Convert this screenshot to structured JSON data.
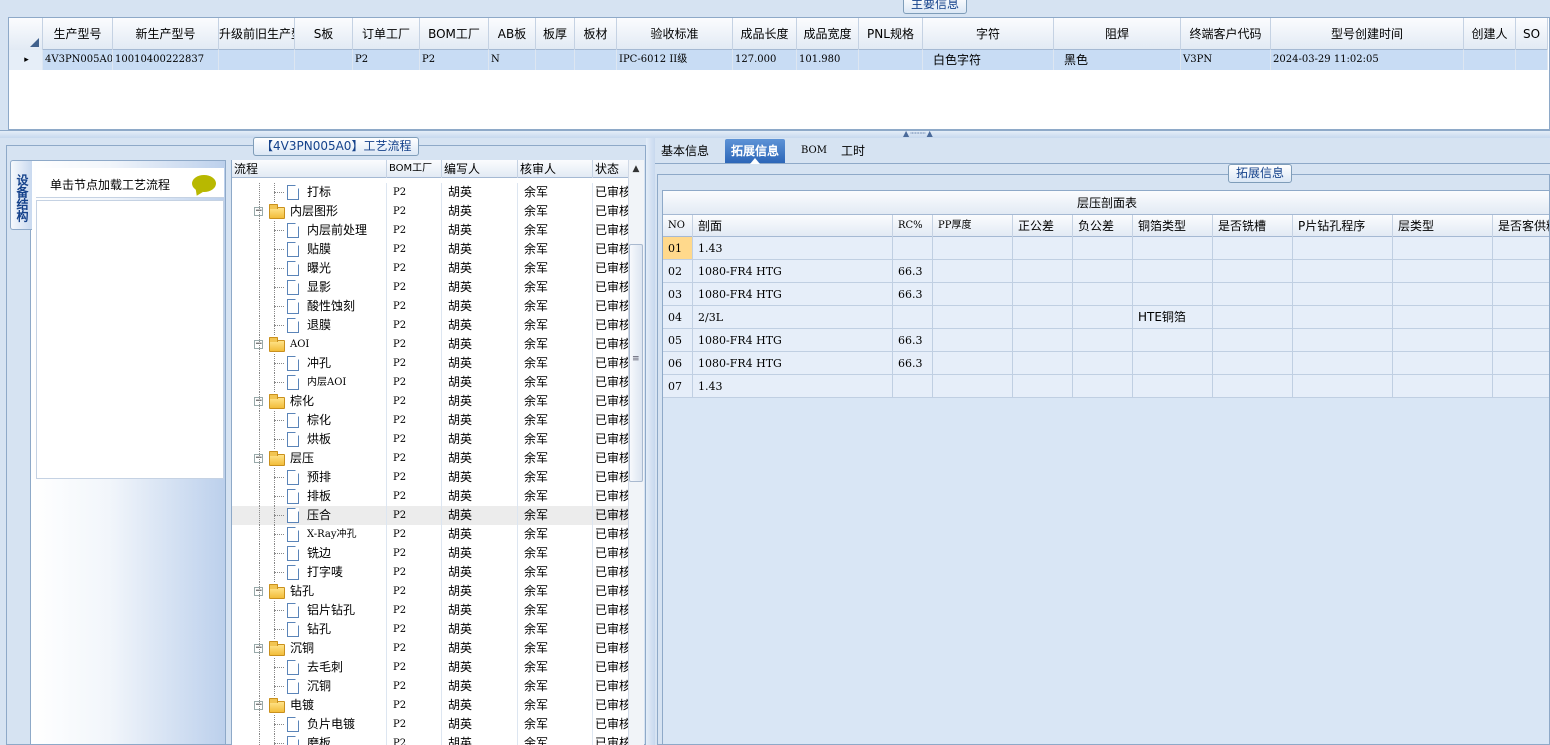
{
  "main_info": {
    "caption": "主要信息",
    "columns": [
      "生产型号",
      "新生产型号",
      "升级前旧生产型号",
      "S板",
      "订单工厂",
      "BOM工厂",
      "AB板",
      "板厚",
      "板材",
      "验收标准",
      "成品长度",
      "成品宽度",
      "PNL规格",
      "字符",
      "阻焊",
      "终端客户代码",
      "型号创建时间",
      "创建人",
      "SO"
    ],
    "row": [
      "4V3PN005A0",
      "10010400222837",
      "",
      "",
      "P2",
      "P2",
      "N",
      "",
      "",
      "IPC-6012 II级",
      "127.000",
      "101.980",
      "",
      "白色字符",
      "黑色",
      "V3PN",
      "2024-03-29 11:02:05",
      "",
      ""
    ],
    "row_marker": "▸"
  },
  "process": {
    "caption": "【4V3PN005A0】工艺流程",
    "side_tab": "设备结构",
    "load_hint": "单击节点加载工艺流程",
    "columns": [
      "流程",
      "BOM工厂",
      "编写人",
      "核审人",
      "状态"
    ],
    "rows": [
      {
        "name": "打标",
        "level": 2,
        "bom": "P2",
        "writer": "胡英",
        "reviewer": "余军",
        "status": "已审核"
      },
      {
        "name": "内层图形",
        "level": 1,
        "bom": "P2",
        "writer": "胡英",
        "reviewer": "余军",
        "status": "已审核"
      },
      {
        "name": "内层前处理",
        "level": 2,
        "bom": "P2",
        "writer": "胡英",
        "reviewer": "余军",
        "status": "已审核"
      },
      {
        "name": "贴膜",
        "level": 2,
        "bom": "P2",
        "writer": "胡英",
        "reviewer": "余军",
        "status": "已审核"
      },
      {
        "name": "曝光",
        "level": 2,
        "bom": "P2",
        "writer": "胡英",
        "reviewer": "余军",
        "status": "已审核"
      },
      {
        "name": "显影",
        "level": 2,
        "bom": "P2",
        "writer": "胡英",
        "reviewer": "余军",
        "status": "已审核"
      },
      {
        "name": "酸性蚀刻",
        "level": 2,
        "bom": "P2",
        "writer": "胡英",
        "reviewer": "余军",
        "status": "已审核"
      },
      {
        "name": "退膜",
        "level": 2,
        "bom": "P2",
        "writer": "胡英",
        "reviewer": "余军",
        "status": "已审核"
      },
      {
        "name": "AOI",
        "level": 1,
        "bom": "P2",
        "writer": "胡英",
        "reviewer": "余军",
        "status": "已审核"
      },
      {
        "name": "冲孔",
        "level": 2,
        "bom": "P2",
        "writer": "胡英",
        "reviewer": "余军",
        "status": "已审核"
      },
      {
        "name": "内层AOI",
        "level": 2,
        "bom": "P2",
        "writer": "胡英",
        "reviewer": "余军",
        "status": "已审核"
      },
      {
        "name": "棕化",
        "level": 1,
        "bom": "P2",
        "writer": "胡英",
        "reviewer": "余军",
        "status": "已审核"
      },
      {
        "name": "棕化",
        "level": 2,
        "bom": "P2",
        "writer": "胡英",
        "reviewer": "余军",
        "status": "已审核"
      },
      {
        "name": "烘板",
        "level": 2,
        "bom": "P2",
        "writer": "胡英",
        "reviewer": "余军",
        "status": "已审核"
      },
      {
        "name": "层压",
        "level": 1,
        "bom": "P2",
        "writer": "胡英",
        "reviewer": "余军",
        "status": "已审核"
      },
      {
        "name": "预排",
        "level": 2,
        "bom": "P2",
        "writer": "胡英",
        "reviewer": "余军",
        "status": "已审核"
      },
      {
        "name": "排板",
        "level": 2,
        "bom": "P2",
        "writer": "胡英",
        "reviewer": "余军",
        "status": "已审核"
      },
      {
        "name": "压合",
        "level": 2,
        "bom": "P2",
        "writer": "胡英",
        "reviewer": "余军",
        "status": "已审核",
        "selected": true
      },
      {
        "name": "X-Ray冲孔",
        "level": 2,
        "bom": "P2",
        "writer": "胡英",
        "reviewer": "余军",
        "status": "已审核"
      },
      {
        "name": "铣边",
        "level": 2,
        "bom": "P2",
        "writer": "胡英",
        "reviewer": "余军",
        "status": "已审核"
      },
      {
        "name": "打字唛",
        "level": 2,
        "bom": "P2",
        "writer": "胡英",
        "reviewer": "余军",
        "status": "已审核"
      },
      {
        "name": "钻孔",
        "level": 1,
        "bom": "P2",
        "writer": "胡英",
        "reviewer": "余军",
        "status": "已审核"
      },
      {
        "name": "铝片钻孔",
        "level": 2,
        "bom": "P2",
        "writer": "胡英",
        "reviewer": "余军",
        "status": "已审核"
      },
      {
        "name": "钻孔",
        "level": 2,
        "bom": "P2",
        "writer": "胡英",
        "reviewer": "余军",
        "status": "已审核"
      },
      {
        "name": "沉铜",
        "level": 1,
        "bom": "P2",
        "writer": "胡英",
        "reviewer": "余军",
        "status": "已审核"
      },
      {
        "name": "去毛刺",
        "level": 2,
        "bom": "P2",
        "writer": "胡英",
        "reviewer": "余军",
        "status": "已审核"
      },
      {
        "name": "沉铜",
        "level": 2,
        "bom": "P2",
        "writer": "胡英",
        "reviewer": "余军",
        "status": "已审核"
      },
      {
        "name": "电镀",
        "level": 1,
        "bom": "P2",
        "writer": "胡英",
        "reviewer": "余军",
        "status": "已审核"
      },
      {
        "name": "负片电镀",
        "level": 2,
        "bom": "P2",
        "writer": "胡英",
        "reviewer": "余军",
        "status": "已审核"
      },
      {
        "name": "磨板",
        "level": 2,
        "bom": "P2",
        "writer": "胡英",
        "reviewer": "余军",
        "status": "已审核"
      }
    ]
  },
  "tabs": {
    "items": [
      "基本信息",
      "拓展信息",
      "BOM",
      "工时"
    ],
    "active": 1
  },
  "extended": {
    "caption": "拓展信息",
    "table_title": "层压剖面表",
    "columns": [
      "NO",
      "剖面",
      "RC%",
      "PP厚度",
      "正公差",
      "负公差",
      "铜箔类型",
      "是否铣槽",
      "P片钻孔程序",
      "层类型",
      "是否客供料"
    ],
    "rows": [
      [
        "01",
        "1.43",
        "",
        "",
        "",
        "",
        "",
        "",
        "",
        "",
        ""
      ],
      [
        "02",
        "1080-FR4 HTG",
        "66.3",
        "",
        "",
        "",
        "",
        "",
        "",
        "",
        ""
      ],
      [
        "03",
        "1080-FR4 HTG",
        "66.3",
        "",
        "",
        "",
        "",
        "",
        "",
        "",
        ""
      ],
      [
        "04",
        "2/3L",
        "",
        "",
        "",
        "",
        "HTE铜箔",
        "",
        "",
        "",
        ""
      ],
      [
        "05",
        "1080-FR4 HTG",
        "66.3",
        "",
        "",
        "",
        "",
        "",
        "",
        "",
        ""
      ],
      [
        "06",
        "1080-FR4 HTG",
        "66.3",
        "",
        "",
        "",
        "",
        "",
        "",
        "",
        ""
      ],
      [
        "07",
        "1.43",
        "",
        "",
        "",
        "",
        "",
        "",
        "",
        "",
        ""
      ]
    ]
  },
  "colors": {
    "selected_row": "#c8dcf4",
    "active_tab": "#2c66b8",
    "highlight_cell": "#ffd98c",
    "panel_bg": "#d6e3f2"
  }
}
